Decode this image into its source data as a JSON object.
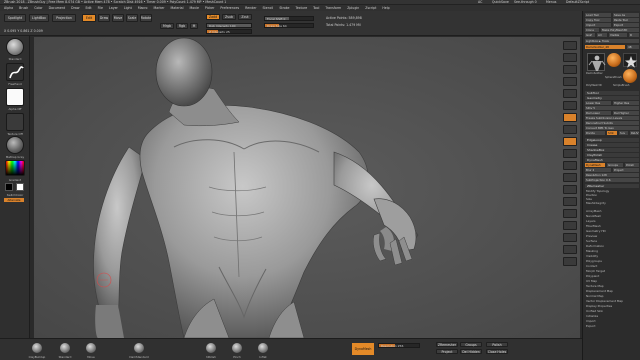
{
  "titlebar": {
    "title": "ZBrush 2018 - ZBrushGuy | Free Mem 8.074 GB • Active Mem 478 • Scratch Disk 4916 • Timer 0.009 • PolyCount 1.479 MP • MeshCount 1",
    "actions": [
      "AC",
      "QuickSave",
      "See-through 0",
      "Menus",
      "DefaultZScript"
    ]
  },
  "menubar": {
    "items": [
      "Alpha",
      "Brush",
      "Color",
      "Document",
      "Draw",
      "Edit",
      "File",
      "Layer",
      "Light",
      "Macro",
      "Marker",
      "Material",
      "Movie",
      "Picker",
      "Preferences",
      "Render",
      "Stencil",
      "Stroke",
      "Texture",
      "Tool",
      "Transform",
      "Zplugin",
      "Zscript",
      "Help"
    ]
  },
  "toolbar": {
    "buttons": {
      "spotlight": "Spotlight",
      "lightbox": "LightBox",
      "projection": "Projection",
      "edit": "Edit",
      "draw": "Draw",
      "move": "Move",
      "scale": "Scale",
      "rotate": "Rotate",
      "mrgb": "Mrgb",
      "rgb": "Rgb",
      "m": "M",
      "zadd": "Zadd",
      "zsub": "Zsub",
      "zcut": "Zcut"
    },
    "sliders": {
      "focal_shift": "Focal Shift 0",
      "draw_size": "Draw Size 64",
      "z_intensity": "Z Intensity 25",
      "rgb_intensity": "Rgb Intensity 100",
      "active_points": "Active Points: 589,898",
      "total_points": "Total Points: 1.479 Mil"
    },
    "coords": "X 0.095  Y 0.861  Z 0.009"
  },
  "leftshelf": {
    "brush_label": "Standard",
    "stroke_label": "FreeHand",
    "alpha_label": "Alpha Off",
    "texture_label": "Texture Off",
    "material_label": "MatCap Gray",
    "gradient_label": "Gradient",
    "switch_label": "SwitchColor",
    "alternate_label": "Alternate"
  },
  "rpanel": {
    "header_buttons": [
      "Load Tool",
      "Save As",
      "Copy Tool",
      "Paste Tool",
      "Import",
      "Export",
      "Clone",
      "Make PolyMesh3D",
      "GoZ",
      "All",
      "Visible",
      "R"
    ],
    "lightbox_tools": "Lightbox ► Tools",
    "tool_name": "DemoSoldier_48",
    "scale": "48",
    "thumbs": [
      "DemoSoldier",
      "SphereBrush",
      "PolyMesh3D",
      "SimpleBrush"
    ],
    "subtool_header": "SubTool",
    "geometry_header": "Geometry",
    "geometry_items": [
      "Lower Res",
      "Higher Res",
      "SDiv 5",
      "Del Lower",
      "Del Higher",
      "Freeze SubDivision Levels",
      "Reconstruct Subdiv",
      "Convert BPR To Geo",
      "Divide",
      "Smt",
      "Suv",
      "ReUV"
    ],
    "edge_header": "EdgeLoop",
    "crease_header": "Crease",
    "shadowbox_header": "ShadowBox",
    "claypolish_header": "ClayPolish",
    "dynamesh_header": "DynaMesh",
    "dynamesh_buttons": [
      "DynaMesh",
      "Groups",
      "Polish",
      "Blur 2",
      "Project"
    ],
    "resolution": "Resolution 128",
    "subproject": "SubProjection 0.6",
    "zremesher_header": "ZRemesher",
    "zremesher_items": [
      "Modify Topology",
      "Position",
      "Size",
      "MeshIntegrity"
    ],
    "list_items": [
      "ArrayMesh",
      "NanoMesh",
      "Layers",
      "FiberMesh",
      "Geometry HD",
      "Preview",
      "Surface",
      "Deformation",
      "Masking",
      "Visibility",
      "Polygroups",
      "Contact",
      "Morph Target",
      "Polypaint",
      "UV Map",
      "Texture Map",
      "Displacement Map",
      "Normal Map",
      "Vector Displacement Map",
      "Display Properties",
      "Unified Skin",
      "Initialize",
      "Import",
      "Export"
    ]
  },
  "rstrip": {
    "icons": [
      "BPR",
      "SPix 3",
      "Scroll",
      "Zoom",
      "Actual",
      "AAHalf",
      "Persp",
      "Floor",
      "Local",
      "L.Sym",
      "Frame",
      "Move",
      "Scale",
      "Rotate",
      "PolyF",
      "Transp",
      "Ghost",
      "Solo",
      "Xpose"
    ]
  },
  "bottom": {
    "items": [
      "ClayBuildup",
      "Standard",
      "Move",
      "DamStandard",
      "hPolish",
      "Pinch",
      "Inflat"
    ],
    "dynamesh_button": "DynaMesh",
    "resolution_slider": "Resolution 256",
    "buttons": [
      "ZRemesher",
      "Groups",
      "Polish",
      "Project",
      "Del Hidden",
      "Close Holes"
    ]
  },
  "colors": {
    "accent": "#e48a28",
    "canvas": "#545454",
    "panel": "#2c2c2c"
  }
}
